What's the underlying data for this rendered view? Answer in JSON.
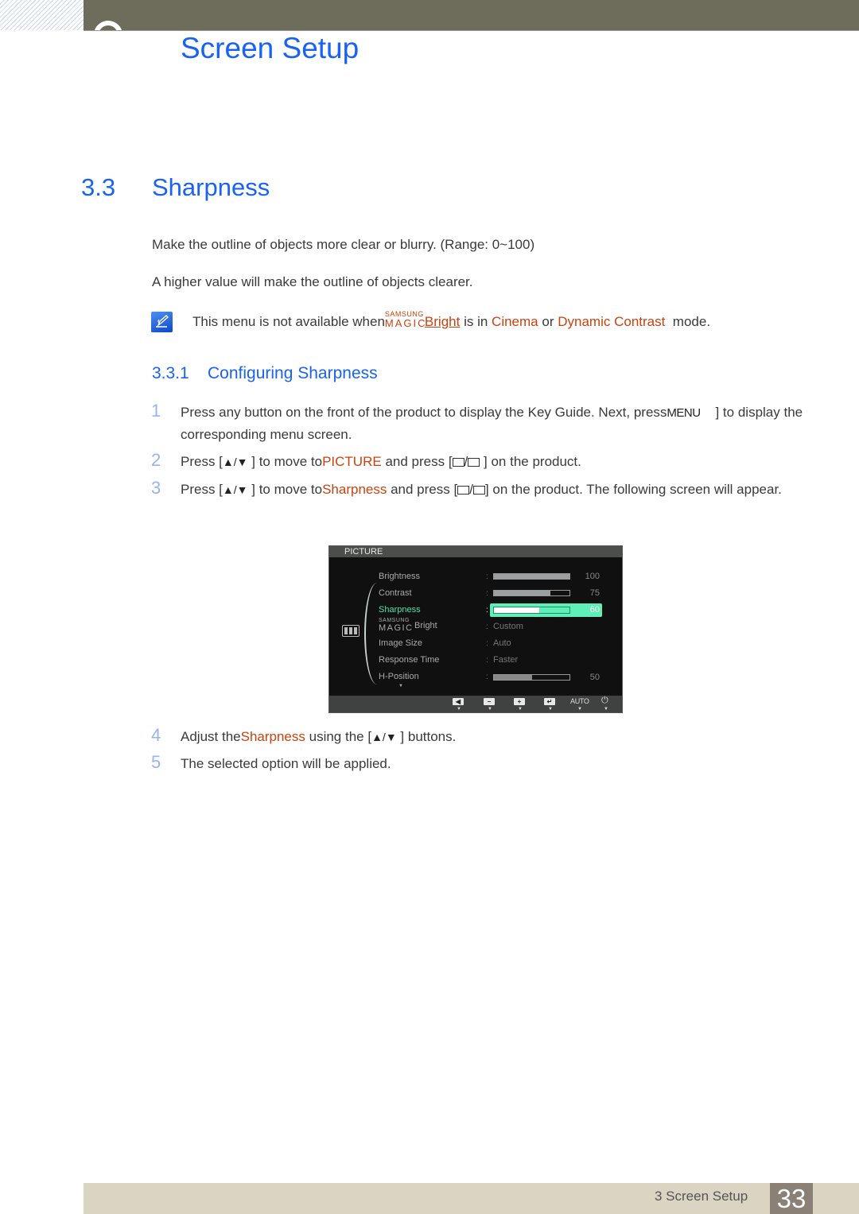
{
  "header": {
    "chapter_title": "Screen Setup"
  },
  "section": {
    "number": "3.3",
    "title": "Sharpness",
    "paragraphs": [
      "Make the outline of objects more clear or blurry. (Range: 0~100)",
      "A higher value will make the outline of objects clearer."
    ],
    "note": {
      "prefix": "This menu is not available when",
      "magic_small": "SAMSUNG",
      "magic_big": "MAGIC",
      "magic_word": "Bright",
      "middle": "is in",
      "mode1": "Cinema",
      "or": "or",
      "mode2": "Dynamic Contrast",
      "suffix": "mode."
    }
  },
  "subsection": {
    "number": "3.3.1",
    "title": "Configuring Sharpness"
  },
  "steps": [
    {
      "num": "1",
      "a": "Press any button on the front of the product to display the Key Guide. Next, press",
      "key": "MENU",
      "b": "] to display the corresponding menu screen."
    },
    {
      "num": "2",
      "a": "Press [",
      "b": "] to move to",
      "target": "PICTURE",
      "c": "and press [",
      "d": "] on the product."
    },
    {
      "num": "3",
      "a": "Press [",
      "b": "] to move to",
      "target": "Sharpness",
      "c": "and press [",
      "d": "] on the product. The following screen will appear."
    },
    {
      "num": "4",
      "a": "Adjust the",
      "target": "Sharpness",
      "b": "using the [",
      "c": "] buttons."
    },
    {
      "num": "5",
      "a": "The selected option will be applied."
    }
  ],
  "osd": {
    "title": "PICTURE",
    "items": [
      {
        "label": "Brightness",
        "type": "bar",
        "value": 100
      },
      {
        "label": "Contrast",
        "type": "bar",
        "value": 75
      },
      {
        "label": "Sharpness",
        "type": "bar",
        "value": 60,
        "selected": true
      },
      {
        "label_small": "SAMSUNG",
        "label_big": "MAGIC",
        "label": "Bright",
        "type": "text",
        "value": "Custom"
      },
      {
        "label": "Image Size",
        "type": "text",
        "value": "Auto"
      },
      {
        "label": "Response Time",
        "type": "text",
        "value": "Faster"
      },
      {
        "label": "H-Position",
        "type": "bar",
        "value": 50
      }
    ],
    "footer_buttons": [
      "left-icon",
      "minus-icon",
      "plus-icon",
      "enter-icon",
      "AUTO",
      "power-icon"
    ]
  },
  "footer": {
    "chapter_label": "3 Screen Setup",
    "page_number": "33"
  },
  "colors": {
    "heading_blue": "#1a62f0",
    "highlight_orange": "#c9420f",
    "osd_selected": "#5ef0b8",
    "header_bar": "#6e6c5a",
    "footer_bar": "#dad4c2",
    "page_badge": "#8b8076"
  }
}
